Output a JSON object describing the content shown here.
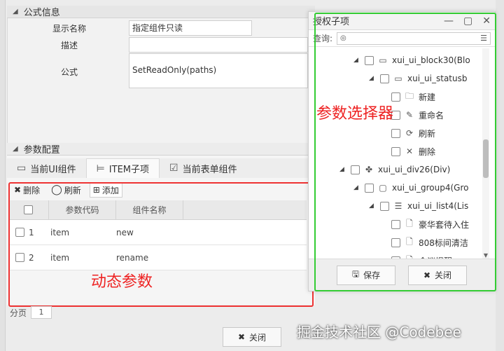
{
  "formula": {
    "section_title": "公式信息",
    "display_name_label": "显示名称",
    "display_name_value": "指定组件只读",
    "desc_label": "描述",
    "desc_value": "",
    "formula_label": "公式",
    "formula_value": "SetReadOnly(paths)"
  },
  "params": {
    "section_title": "参数配置",
    "tabs": [
      {
        "label": "当前UI组件",
        "icon": "window-icon"
      },
      {
        "label": "ITEM子项",
        "icon": "tree-icon"
      },
      {
        "label": "当前表单组件",
        "icon": "edit-icon"
      }
    ],
    "toolbar": {
      "delete": "删除",
      "refresh": "刷新",
      "add": "添加"
    },
    "columns": [
      "参数代码",
      "组件名称"
    ],
    "rows": [
      {
        "no": "1",
        "code": "item",
        "name": "new"
      },
      {
        "no": "2",
        "code": "item",
        "name": "rename"
      }
    ],
    "annotation": "动态参数",
    "pager_label": "分页",
    "pager_value": "1",
    "close_label": "关闭"
  },
  "dialog": {
    "title": "授权子项",
    "query_label": "查询:",
    "annotation": "参数选择器",
    "tree": [
      {
        "label": "xui_ui_block30(Blo",
        "indent": 1,
        "arrow": "◢",
        "icon": "▭"
      },
      {
        "label": "xui_ui_statusb",
        "indent": 2,
        "arrow": "◢",
        "icon": "▭"
      },
      {
        "label": "新建",
        "indent": 3,
        "arrow": "",
        "icon": "🗀"
      },
      {
        "label": "重命名",
        "indent": 3,
        "arrow": "",
        "icon": "✎"
      },
      {
        "label": "刷新",
        "indent": 3,
        "arrow": "",
        "icon": "⟳"
      },
      {
        "label": "删除",
        "indent": 3,
        "arrow": "",
        "icon": "✕"
      },
      {
        "label": "xui_ui_div26(Div)",
        "indent": 0,
        "arrow": "◢",
        "icon": "✤"
      },
      {
        "label": "xui_ui_group4(Gro",
        "indent": 1,
        "arrow": "◢",
        "icon": "▢"
      },
      {
        "label": "xui_ui_list4(Lis",
        "indent": 2,
        "arrow": "◢",
        "icon": "☰"
      },
      {
        "label": "豪华套待入住",
        "indent": 3,
        "arrow": "",
        "icon": "🗋"
      },
      {
        "label": "808标间清洁",
        "indent": 3,
        "arrow": "",
        "icon": "🗋"
      },
      {
        "label": "会议提醒",
        "indent": 3,
        "arrow": "",
        "icon": "🗋"
      }
    ],
    "save_label": "保存",
    "close_label": "关闭"
  },
  "watermark": "掘金技术社区 @Codebee",
  "colors": {
    "red_annotation": "#e22222",
    "green_box": "#33cc33"
  }
}
